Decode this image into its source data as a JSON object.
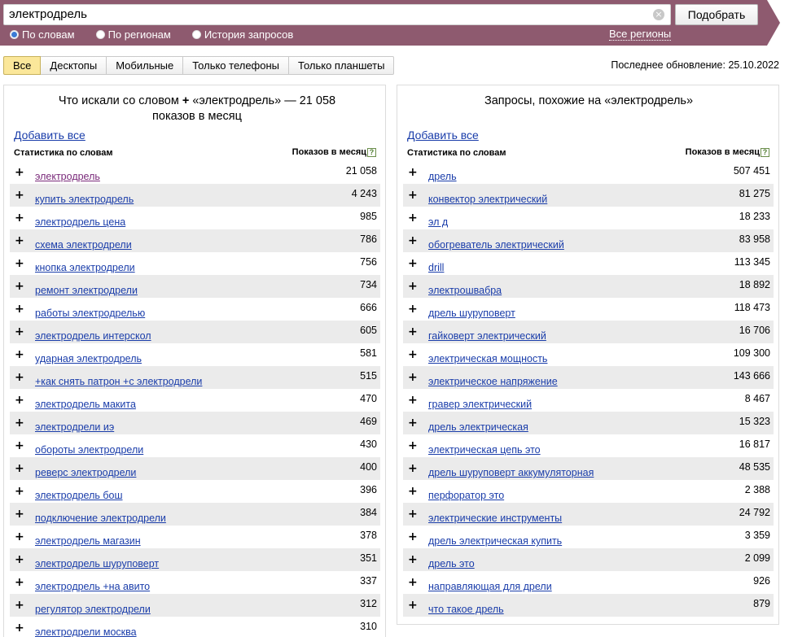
{
  "search": {
    "query": "электродрель",
    "button_label": "Подобрать",
    "modes": [
      {
        "label": "По словам",
        "selected": true
      },
      {
        "label": "По регионам",
        "selected": false
      },
      {
        "label": "История запросов",
        "selected": false
      }
    ],
    "regions_link": "Все регионы"
  },
  "tabs": [
    {
      "label": "Все",
      "active": true
    },
    {
      "label": "Десктопы",
      "active": false
    },
    {
      "label": "Мобильные",
      "active": false
    },
    {
      "label": "Только телефоны",
      "active": false
    },
    {
      "label": "Только планшеты",
      "active": false
    }
  ],
  "last_update": "Последнее обновление: 25.10.2022",
  "colors": {
    "bar": "#8e5a6f",
    "link": "#1a3daa",
    "active_tab": "#fbe79a"
  },
  "left_panel": {
    "title_part1": "Что искали со словом",
    "title_plus": "+",
    "title_part2": "«электродрель» — 21 058",
    "title_line2": "показов в месяц",
    "add_all": "Добавить все",
    "col_stats": "Статистика по словам",
    "col_shows": "Показов в месяц",
    "rows": [
      {
        "phrase": "электродрель",
        "count": "21 058"
      },
      {
        "phrase": "купить электродрель",
        "count": "4 243"
      },
      {
        "phrase": "электродрель цена",
        "count": "985"
      },
      {
        "phrase": "схема электродрели",
        "count": "786"
      },
      {
        "phrase": "кнопка электродрели",
        "count": "756"
      },
      {
        "phrase": "ремонт электродрели",
        "count": "734"
      },
      {
        "phrase": "работы электродрелью",
        "count": "666"
      },
      {
        "phrase": "электродрель интерскол",
        "count": "605"
      },
      {
        "phrase": "ударная электродрель",
        "count": "581"
      },
      {
        "phrase": "+как снять патрон +с электродрели",
        "count": "515"
      },
      {
        "phrase": "электродрель макита",
        "count": "470"
      },
      {
        "phrase": "электродрели иэ",
        "count": "469"
      },
      {
        "phrase": "обороты электродрели",
        "count": "430"
      },
      {
        "phrase": "реверс электродрели",
        "count": "400"
      },
      {
        "phrase": "электродрель бош",
        "count": "396"
      },
      {
        "phrase": "подключение электродрели",
        "count": "384"
      },
      {
        "phrase": "электродрель магазин",
        "count": "378"
      },
      {
        "phrase": "электродрель шуруповерт",
        "count": "351"
      },
      {
        "phrase": "электродрель +на авито",
        "count": "337"
      },
      {
        "phrase": "регулятор электродрели",
        "count": "312"
      },
      {
        "phrase": "электродрели москва",
        "count": "310"
      }
    ]
  },
  "right_panel": {
    "title": "Запросы, похожие на «электродрель»",
    "add_all": "Добавить все",
    "col_stats": "Статистика по словам",
    "col_shows": "Показов в месяц",
    "rows": [
      {
        "phrase": "дрель",
        "count": "507 451"
      },
      {
        "phrase": "конвектор электрический",
        "count": "81 275"
      },
      {
        "phrase": "эл д",
        "count": "18 233"
      },
      {
        "phrase": "обогреватель электрический",
        "count": "83 958"
      },
      {
        "phrase": "drill",
        "count": "113 345"
      },
      {
        "phrase": "электрошвабра",
        "count": "18 892"
      },
      {
        "phrase": "дрель шуруповерт",
        "count": "118 473"
      },
      {
        "phrase": "гайковерт электрический",
        "count": "16 706"
      },
      {
        "phrase": "электрическая мощность",
        "count": "109 300"
      },
      {
        "phrase": "электрическое напряжение",
        "count": "143 666"
      },
      {
        "phrase": "гравер электрический",
        "count": "8 467"
      },
      {
        "phrase": "дрель электрическая",
        "count": "15 323"
      },
      {
        "phrase": "электрическая цепь это",
        "count": "16 817"
      },
      {
        "phrase": "дрель шуруповерт аккумуляторная",
        "count": "48 535"
      },
      {
        "phrase": "перфоратор это",
        "count": "2 388"
      },
      {
        "phrase": "электрические инструменты",
        "count": "24 792"
      },
      {
        "phrase": "дрель электрическая купить",
        "count": "3 359"
      },
      {
        "phrase": "дрель это",
        "count": "2 099"
      },
      {
        "phrase": "направляющая для дрели",
        "count": "926"
      },
      {
        "phrase": "что такое дрель",
        "count": "879"
      }
    ]
  }
}
